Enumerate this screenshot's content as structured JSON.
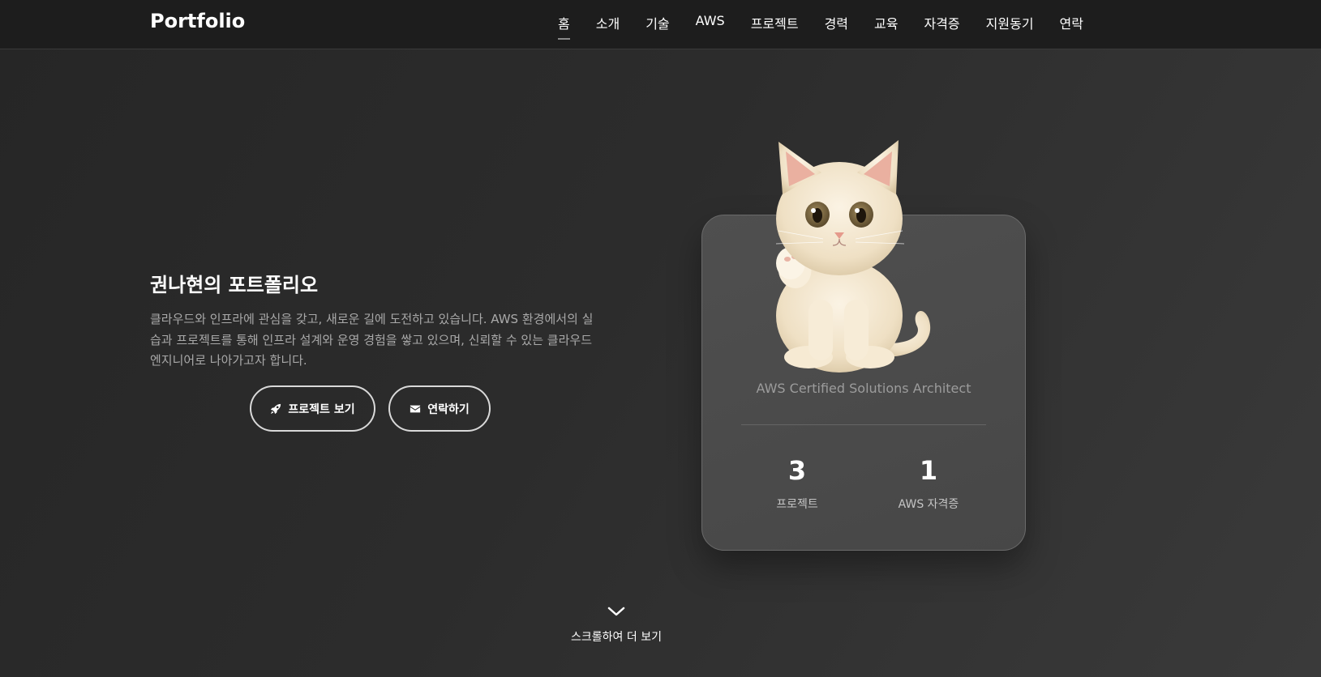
{
  "nav": {
    "logo": "Portfolio",
    "items": [
      {
        "label": "홈",
        "active": true
      },
      {
        "label": "소개"
      },
      {
        "label": "기술"
      },
      {
        "label": "AWS"
      },
      {
        "label": "프로젝트"
      },
      {
        "label": "경력"
      },
      {
        "label": "교육"
      },
      {
        "label": "자격증"
      },
      {
        "label": "지원동기"
      },
      {
        "label": "연락"
      }
    ]
  },
  "hero": {
    "title": "권나현의 포트폴리오",
    "description": "클라우드와 인프라에 관심을 갖고, 새로운 길에 도전하고 있습니다. AWS 환경에서의 실습과 프로젝트를 통해 인프라 설계와 운영 경험을 쌓고 있으며, 신뢰할 수 있는 클라우드 엔지니어로 나아가고자 합니다.",
    "buttons": {
      "projects": {
        "label": "프로젝트 보기",
        "icon": "rocket-icon"
      },
      "contact": {
        "label": "연락하기",
        "icon": "envelope-icon"
      }
    }
  },
  "profile_card": {
    "image": "kitten-illustration",
    "subtitle": "AWS Certified Solutions Architect",
    "stats": [
      {
        "value": "3",
        "label": "프로젝트"
      },
      {
        "value": "1",
        "label": "AWS 자격증"
      }
    ]
  },
  "scroll": {
    "label": "스크롤하여 더 보기",
    "icon": "chevron-down-icon"
  },
  "colors": {
    "background": "#2b2b2b",
    "navbar": "#1d1d1d",
    "card": "#4b4b4b",
    "text": "#ffffff",
    "muted": "#a9a9a9"
  }
}
